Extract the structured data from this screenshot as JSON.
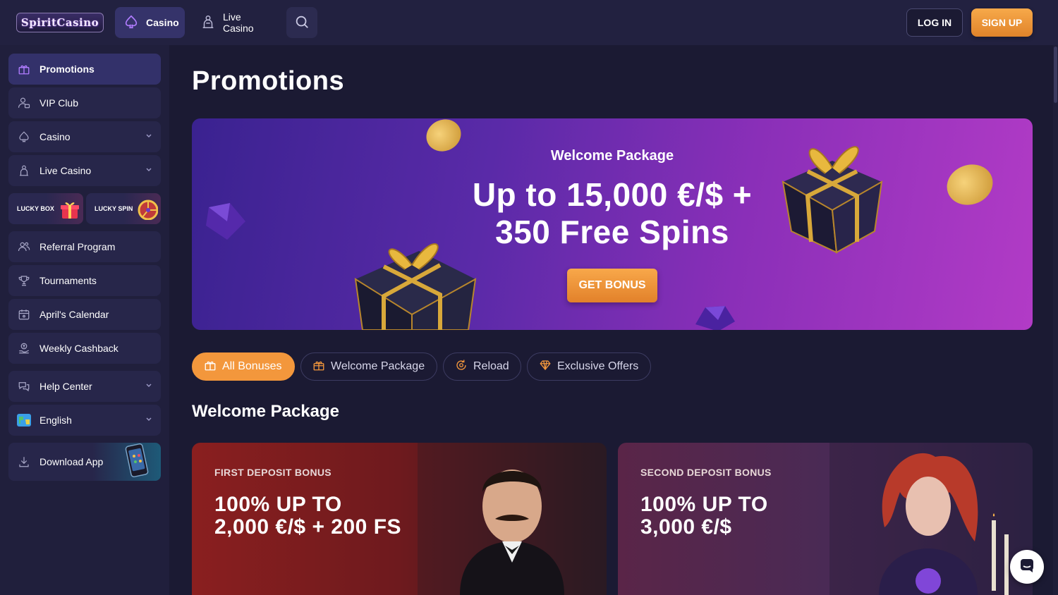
{
  "header": {
    "logo": "SpiritCasino",
    "nav": [
      {
        "label": "Casino",
        "icon": "spade-icon"
      },
      {
        "label": "Live Casino",
        "icon": "dealer-icon"
      }
    ],
    "search_icon": "search-icon",
    "login_label": "LOG IN",
    "signup_label": "SIGN UP"
  },
  "sidebar": {
    "items": [
      {
        "label": "Promotions",
        "icon": "gift-icon",
        "active": true
      },
      {
        "label": "VIP Club",
        "icon": "vip-user-icon"
      },
      {
        "label": "Casino",
        "icon": "spade-icon",
        "chevron": true
      },
      {
        "label": "Live Casino",
        "icon": "dealer-icon",
        "chevron": true
      },
      {
        "label": "Referral Program",
        "icon": "users-icon"
      },
      {
        "label": "Tournaments",
        "icon": "trophy-icon"
      },
      {
        "label": "April's Calendar",
        "icon": "calendar-icon"
      },
      {
        "label": "Weekly Cashback",
        "icon": "cashback-icon"
      },
      {
        "label": "Help Center",
        "icon": "chat-bubbles-icon",
        "chevron": true
      },
      {
        "label": "English",
        "icon": "globe-flag-icon",
        "chevron": true
      }
    ],
    "lucky_box": "LUCKY BOX",
    "lucky_spin": "LUCKY SPIN",
    "download_app": "Download App"
  },
  "main": {
    "title": "Promotions",
    "hero": {
      "subtitle": "Welcome Package",
      "title_line1": "Up to 15,000 €/$ +",
      "title_line2": "350 Free Spins",
      "button": "GET BONUS"
    },
    "filters": [
      {
        "label": "All Bonuses",
        "icon": "gift-icon",
        "active": true
      },
      {
        "label": "Welcome Package",
        "icon": "gift-box-icon"
      },
      {
        "label": "Reload",
        "icon": "reload-icon"
      },
      {
        "label": "Exclusive Offers",
        "icon": "diamond-icon"
      }
    ],
    "section_title": "Welcome Package",
    "cards": [
      {
        "kicker": "FIRST DEPOSIT BONUS",
        "line1": "100% UP TO",
        "line2": "2,000 €/$ + 200 FS"
      },
      {
        "kicker": "SECOND DEPOSIT BONUS",
        "line1": "100% UP TO",
        "line2": "3,000 €/$"
      }
    ]
  },
  "colors": {
    "accent": "#f3973c",
    "background": "#1b1a33",
    "panel": "#27264a",
    "active": "#33316a"
  }
}
